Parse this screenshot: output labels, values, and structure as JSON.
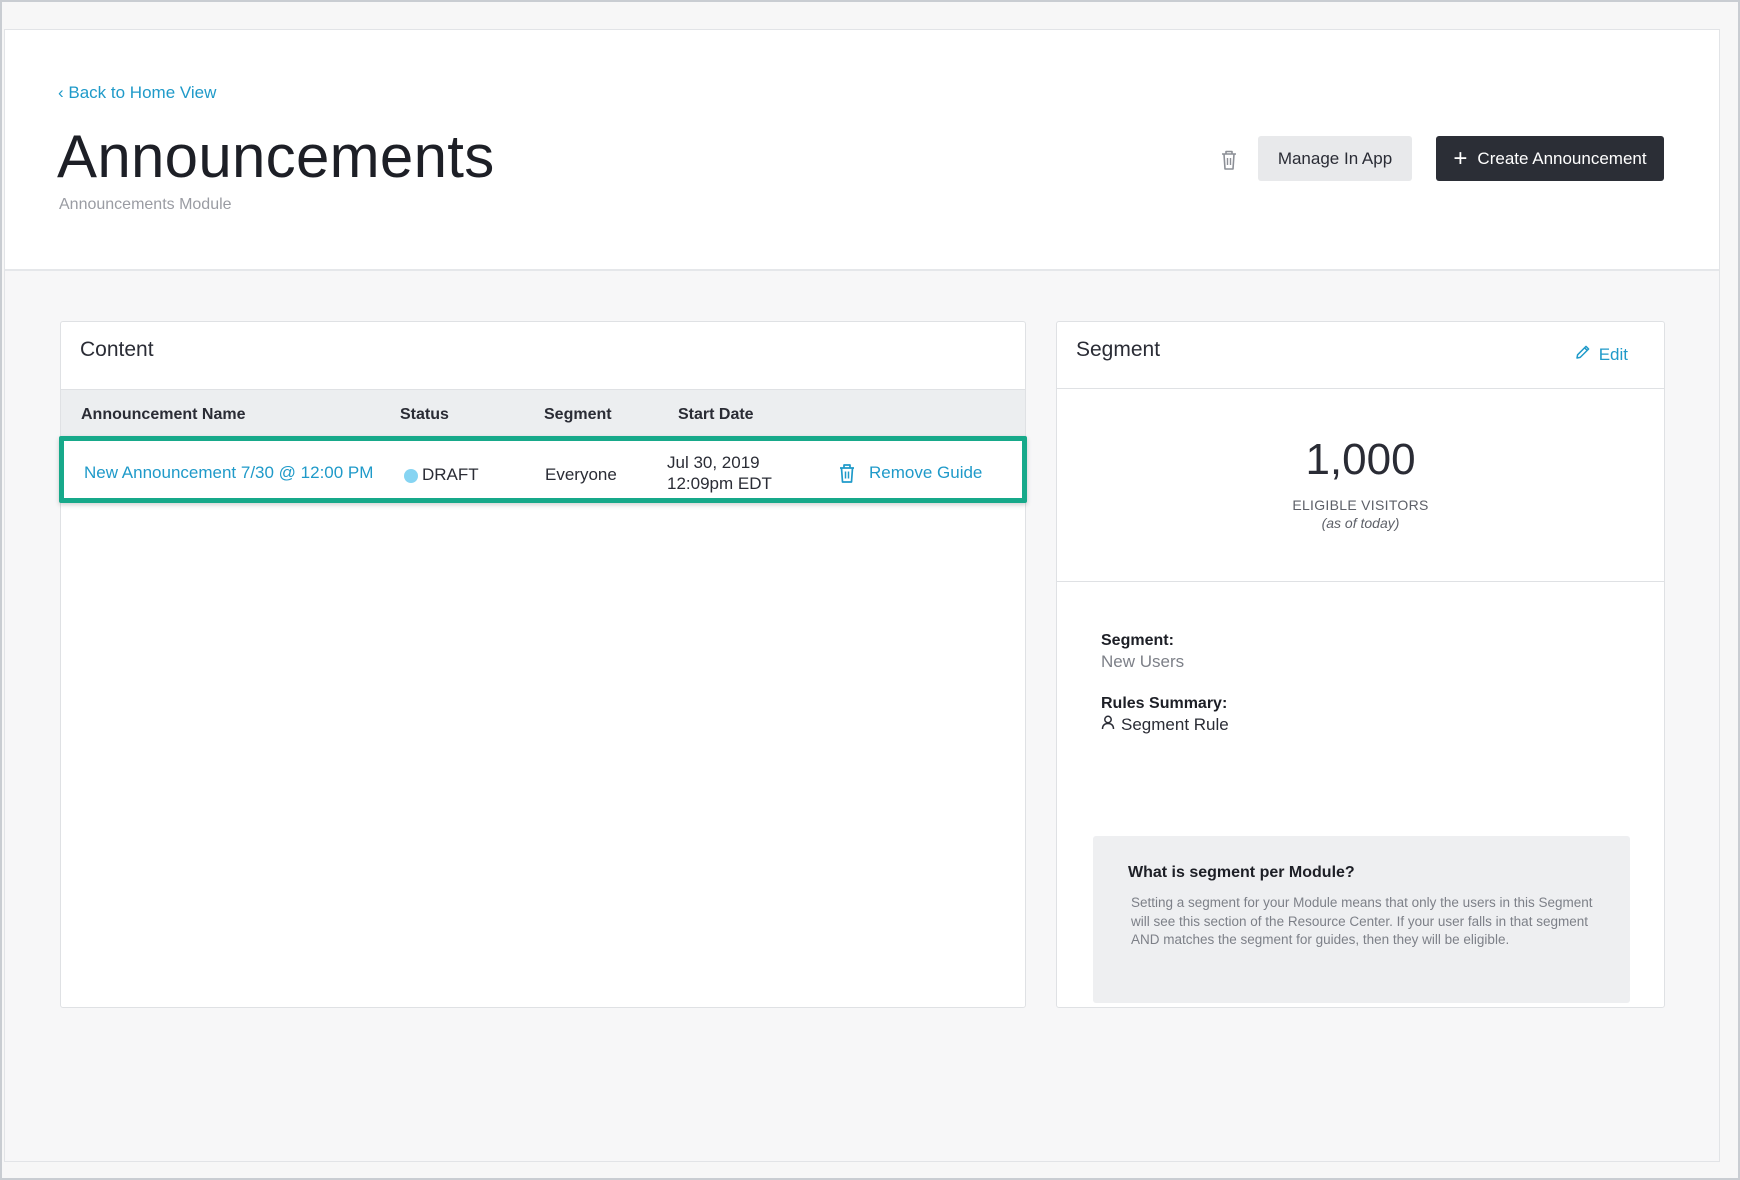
{
  "header": {
    "back_link": "‹ Back to Home View",
    "title": "Announcements",
    "subtitle": "Announcements Module",
    "manage_button": "Manage In App",
    "create_button": "Create Announcement",
    "delete_icon": "trash-icon"
  },
  "content": {
    "title": "Content",
    "columns": [
      "Announcement Name",
      "Status",
      "Segment",
      "Start Date"
    ],
    "rows": [
      {
        "name": "New Announcement 7/30 @ 12:00 PM",
        "status": "DRAFT",
        "status_color": "#86d4f2",
        "segment": "Everyone",
        "start_date_line1": "Jul 30, 2019",
        "start_date_line2": "12:09pm EDT",
        "action": "Remove Guide",
        "action_icon": "trash-icon"
      }
    ]
  },
  "segment_panel": {
    "title": "Segment",
    "edit_label": "Edit",
    "edit_icon": "pencil-icon",
    "visitor_count": "1,000",
    "visitor_label": "ELIGIBLE VISITORS",
    "visitor_sub": "(as of today)",
    "segment_label": "Segment:",
    "segment_value": "New Users",
    "rules_label": "Rules Summary:",
    "rules_value": "Segment Rule",
    "rules_icon": "person-icon",
    "info_title": "What is segment per Module?",
    "info_text": "Setting a segment for your Module means that only the users in this Segment will see this section of the Resource Center. If your user falls in that segment AND matches the segment for guides, then they will be eligible."
  },
  "colors": {
    "link": "#1f9ac9",
    "highlight": "#17a98a",
    "primary_button": "#2b2e36",
    "secondary_button": "#e8e9eb"
  }
}
